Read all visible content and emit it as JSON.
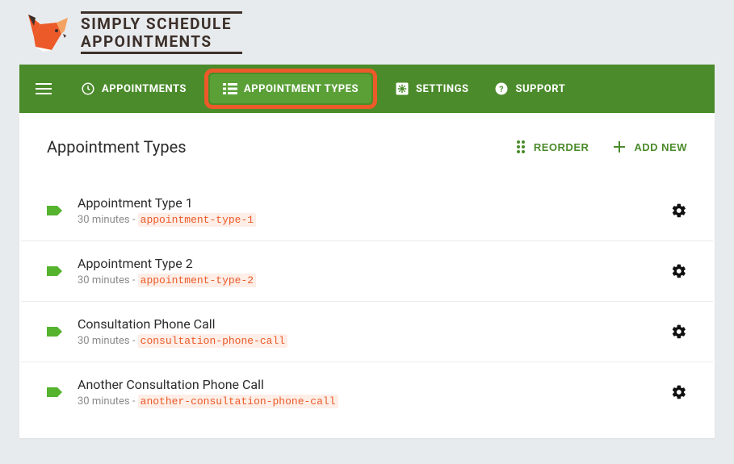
{
  "logo": {
    "line1": "SIMPLY SCHEDULE",
    "line2": "APPOINTMENTS"
  },
  "nav": {
    "appointments": "APPOINTMENTS",
    "appointment_types": "APPOINTMENT TYPES",
    "settings": "SETTINGS",
    "support": "SUPPORT"
  },
  "page": {
    "title": "Appointment Types",
    "reorder": "REORDER",
    "add_new": "ADD NEW"
  },
  "items": [
    {
      "title": "Appointment Type 1",
      "duration": "30 minutes",
      "slug": "appointment-type-1"
    },
    {
      "title": "Appointment Type 2",
      "duration": "30 minutes",
      "slug": "appointment-type-2"
    },
    {
      "title": "Consultation Phone Call",
      "duration": "30 minutes",
      "slug": "consultation-phone-call"
    },
    {
      "title": "Another Consultation Phone Call",
      "duration": "30 minutes",
      "slug": "another-consultation-phone-call"
    }
  ]
}
